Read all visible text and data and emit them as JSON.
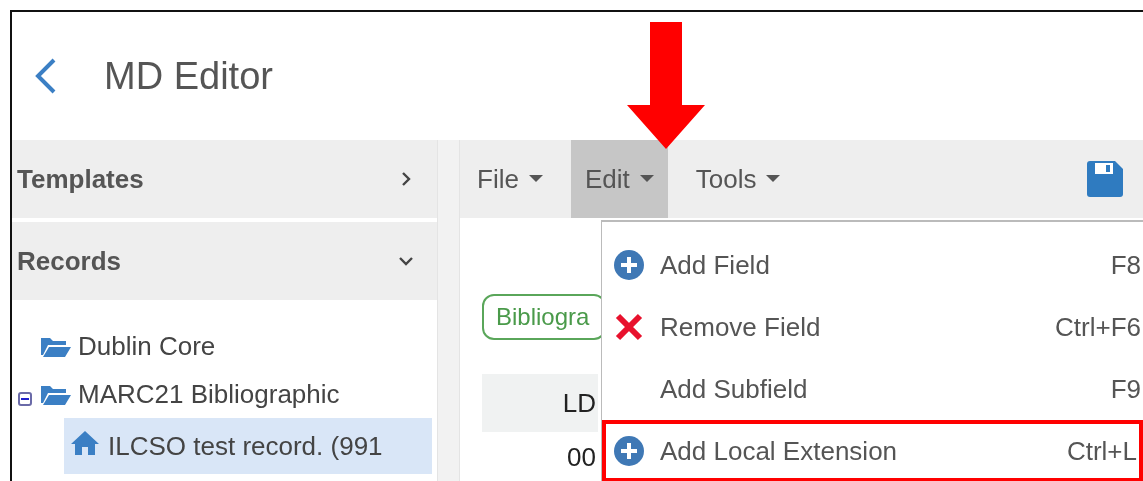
{
  "window": {
    "title": "MD Editor"
  },
  "sidebar": {
    "sections": [
      {
        "label": "Templates",
        "expanded": false
      },
      {
        "label": "Records",
        "expanded": true
      }
    ],
    "tree": [
      {
        "label": "Dublin Core"
      },
      {
        "label": "MARC21 Bibliographic",
        "expanded": true,
        "children": [
          {
            "label": "ILCSO test record. (991",
            "selected": true
          }
        ]
      }
    ]
  },
  "menubar": [
    {
      "label": "File",
      "selected": false
    },
    {
      "label": "Edit",
      "selected": true
    },
    {
      "label": "Tools",
      "selected": false
    }
  ],
  "record": {
    "badge": "Bibliogra",
    "rows": [
      {
        "tag": "LD",
        "kind": "header"
      },
      {
        "tag": "00",
        "kind": "plain"
      }
    ]
  },
  "dropdown": [
    {
      "label": "Add Field",
      "shortcut": "F8",
      "kind": "add",
      "highlighted": false
    },
    {
      "label": "Remove Field",
      "shortcut": "Ctrl+F6",
      "kind": "remove",
      "highlighted": false
    },
    {
      "label": "Add Subfield",
      "shortcut": "F9",
      "kind": "none",
      "highlighted": false
    },
    {
      "label": "Add Local Extension",
      "shortcut": "Ctrl+L",
      "kind": "add",
      "highlighted": true
    }
  ],
  "callout_arrow": true
}
